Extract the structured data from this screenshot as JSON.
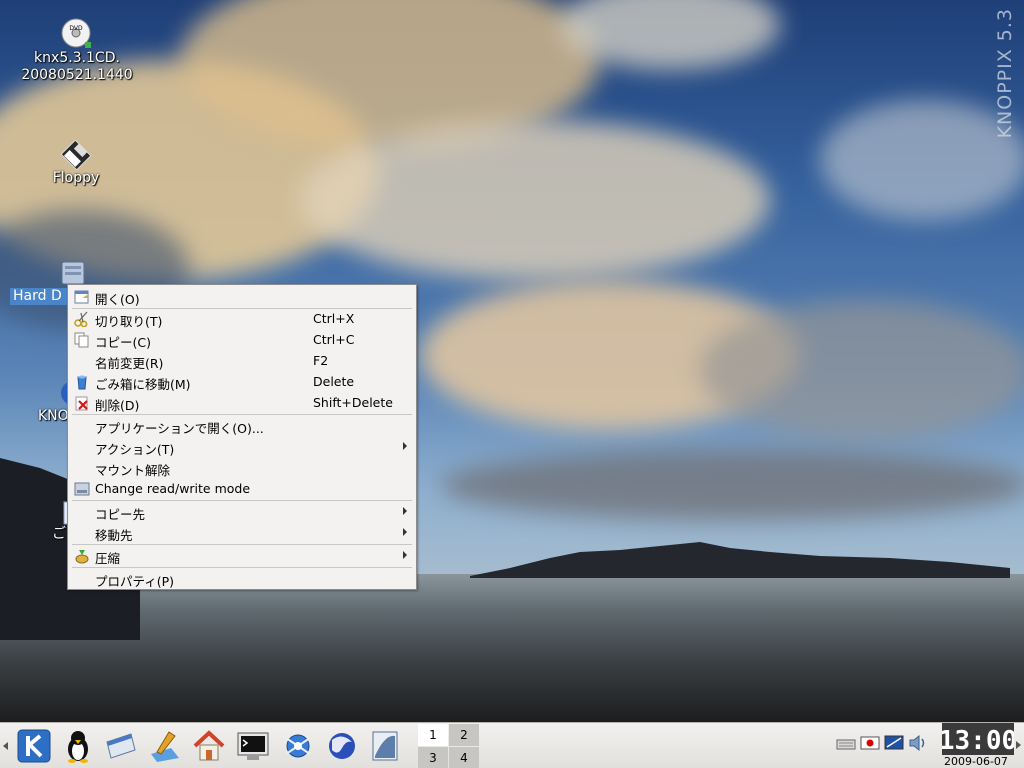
{
  "watermark": "KNOPPIX 5.3",
  "desktop_icons": [
    {
      "line1": "knx5.3.1CD.",
      "line2": "20080521.1440",
      "icon": "dvd-icon"
    },
    {
      "line1": "Floppy",
      "icon": "floppy-icon"
    },
    {
      "line1": "Hard D",
      "icon": "hard-disk-icon",
      "selected": true
    },
    {
      "line1": "KNO",
      "icon": "knoppix-icon"
    },
    {
      "line1": "ご",
      "icon": "trash-icon"
    }
  ],
  "context_menu": {
    "items": [
      {
        "label": "開く(O)",
        "underline": "O",
        "shortcut": "",
        "icon": "open-icon"
      },
      {
        "label": "切り取り(T)",
        "shortcut": "Ctrl+X",
        "icon": "scissors-icon"
      },
      {
        "label": "コピー(C)",
        "shortcut": "Ctrl+C",
        "icon": "copy-icon"
      },
      {
        "label": "名前変更(R)",
        "shortcut": "F2",
        "icon": ""
      },
      {
        "label": "ごみ箱に移動(M)",
        "shortcut": "Delete",
        "icon": "trash-move-icon"
      },
      {
        "label": "削除(D)",
        "shortcut": "Shift+Delete",
        "icon": "delete-icon"
      },
      {
        "label": "アプリケーションで開く(O)...",
        "shortcut": "",
        "icon": ""
      },
      {
        "label": "アクション(T)",
        "submenu": true,
        "icon": ""
      },
      {
        "label": "マウント解除",
        "shortcut": "",
        "icon": ""
      },
      {
        "label": "Change read/write mode",
        "shortcut": "",
        "icon": "drive-icon"
      },
      {
        "label": "コピー先",
        "submenu": true,
        "icon": ""
      },
      {
        "label": "移動先",
        "submenu": true,
        "icon": ""
      },
      {
        "label": "圧縮",
        "submenu": true,
        "icon": "compress-icon"
      },
      {
        "label": "プロパティ(P)",
        "shortcut": "",
        "icon": ""
      }
    ]
  },
  "taskbar": {
    "launchers": [
      "kde-menu-icon",
      "penguin-icon",
      "window-icon",
      "paint-icon",
      "home-icon",
      "terminal-icon",
      "konqueror-icon",
      "browser-icon",
      "office-icon"
    ],
    "pager": [
      "1",
      "2",
      "3",
      "4"
    ],
    "active_desktop": "1",
    "tray_icons": [
      "keyboard-icon",
      "language-flag-icon",
      "display-icon",
      "volume-icon"
    ],
    "clock_time": "13:00",
    "clock_date": "2009-06-07"
  }
}
